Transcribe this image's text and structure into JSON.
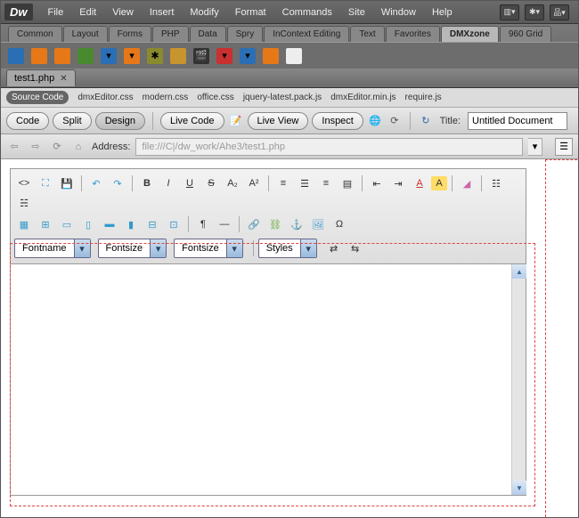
{
  "menubar": {
    "items": [
      "File",
      "Edit",
      "View",
      "Insert",
      "Modify",
      "Format",
      "Commands",
      "Site",
      "Window",
      "Help"
    ]
  },
  "insert_tabs": [
    "Common",
    "Layout",
    "Forms",
    "PHP",
    "Data",
    "Spry",
    "InContext Editing",
    "Text",
    "Favorites",
    "DMXzone",
    "960 Grid"
  ],
  "insert_active": "DMXzone",
  "doc_tab": "test1.php",
  "related": {
    "source": "Source Code",
    "files": [
      "dmxEditor.css",
      "modern.css",
      "office.css",
      "jquery-latest.pack.js",
      "dmxEditor.min.js",
      "require.js"
    ]
  },
  "view_buttons": {
    "code": "Code",
    "split": "Split",
    "design": "Design",
    "livecode": "Live Code",
    "liveview": "Live View",
    "inspect": "Inspect"
  },
  "title_label": "Title:",
  "title_value": "Untitled Document",
  "address_label": "Address:",
  "address_value": "file:///C|/dw_work/Ahe3/test1.php",
  "rte": {
    "fontname": "Fontname",
    "fontsize": "Fontsize",
    "fontsize2": "Fontsize",
    "styles": "Styles"
  }
}
